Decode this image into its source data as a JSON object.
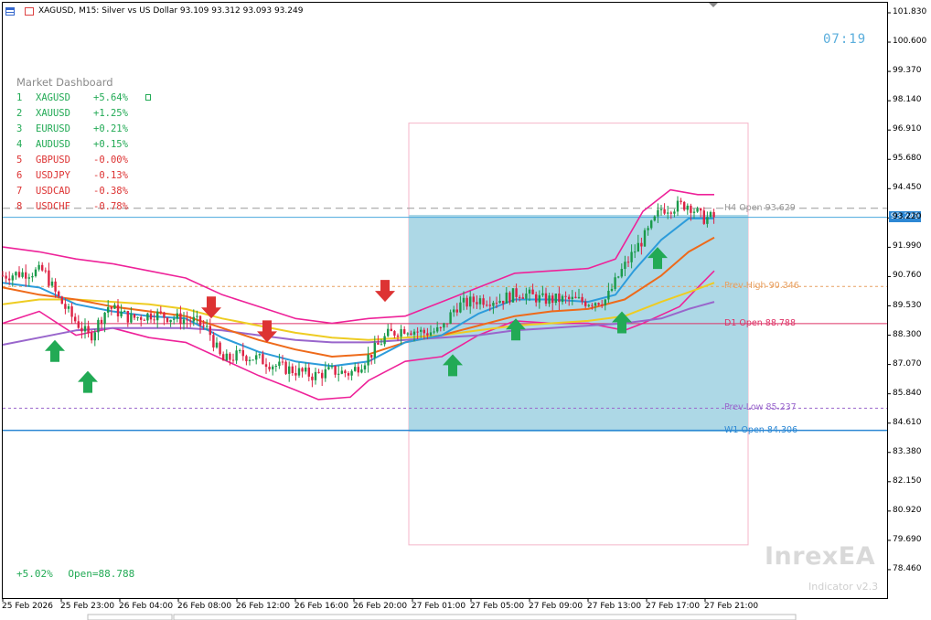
{
  "header": {
    "symbol_line": "XAGUSD, M15:  Silver vs US Dollar  93.109 93.312 93.093 93.249"
  },
  "clock": "07:19",
  "dashboard": {
    "title": "Market Dashboard",
    "rows": [
      {
        "rank": "1",
        "symbol": "XAGUSD",
        "change": "+5.64%",
        "color": "#22aa55"
      },
      {
        "rank": "2",
        "symbol": "XAUUSD",
        "change": "+1.25%",
        "color": "#22aa55"
      },
      {
        "rank": "3",
        "symbol": "EURUSD",
        "change": "+0.21%",
        "color": "#22aa55"
      },
      {
        "rank": "4",
        "symbol": "AUDUSD",
        "change": "+0.15%",
        "color": "#22aa55"
      },
      {
        "rank": "5",
        "symbol": "GBPUSD",
        "change": "-0.00%",
        "color": "#dd3333"
      },
      {
        "rank": "6",
        "symbol": "USDJPY",
        "change": "-0.13%",
        "color": "#dd3333"
      },
      {
        "rank": "7",
        "symbol": "USDCAD",
        "change": "-0.38%",
        "color": "#dd3333"
      },
      {
        "rank": "8",
        "symbol": "USDCHF",
        "change": "-0.78%",
        "color": "#dd3333"
      }
    ]
  },
  "summary": {
    "change": "+5.02%",
    "open": "Open=88.788"
  },
  "brand": {
    "name": "InrexEA",
    "version": "Indicator v2.3"
  },
  "current_price": "93.249",
  "levels": [
    {
      "label": "H4 Open  93.629",
      "price": 93.629,
      "color": "#999999",
      "style": "dashed"
    },
    {
      "label": "Prev High  90.346",
      "price": 90.346,
      "color": "#e8a060",
      "style": "dotted"
    },
    {
      "label": "D1 Open  88.788",
      "price": 88.788,
      "color": "#dd3366",
      "style": "solid"
    },
    {
      "label": "Prev Low  85.237",
      "price": 85.237,
      "color": "#9966cc",
      "style": "dotted"
    },
    {
      "label": "W1 Open  84.306",
      "price": 84.306,
      "color": "#2d88d4",
      "style": "solid"
    }
  ],
  "colors": {
    "bull_candle": "#1a9a4a",
    "bear_candle": "#dd2244",
    "bollinger": "#ee2299",
    "ma_fast": "#2d9cdb",
    "ma_mid": "#ee6a1a",
    "ma_slow": "#eecc22",
    "ma_long": "#9966cc",
    "zone_fill": "#add8e6",
    "zone_border": "#f4b6c8",
    "buy_arrow": "#22aa55",
    "sell_arrow": "#dd3333"
  },
  "chart_data": {
    "type": "candlestick",
    "symbol": "XAGUSD",
    "timeframe": "M15",
    "y_ticks": [
      "101.830",
      "100.600",
      "99.370",
      "98.140",
      "96.910",
      "95.680",
      "94.450",
      "93.220",
      "91.990",
      "90.760",
      "89.530",
      "88.300",
      "87.070",
      "85.840",
      "84.610",
      "83.380",
      "82.150",
      "80.920",
      "79.690",
      "78.460"
    ],
    "ylim": [
      77.6,
      102.5
    ],
    "x_ticks": [
      "25 Feb 2026",
      "25 Feb 23:00",
      "26 Feb 04:00",
      "26 Feb 08:00",
      "26 Feb 12:00",
      "26 Feb 16:00",
      "26 Feb 20:00",
      "27 Feb 01:00",
      "27 Feb 05:00",
      "27 Feb 09:00",
      "27 Feb 13:00",
      "27 Feb 17:00",
      "27 Feb 21:00"
    ],
    "price_path": [
      [
        0,
        90.8
      ],
      [
        20,
        90.9
      ],
      [
        45,
        91.0
      ],
      [
        60,
        89.9
      ],
      [
        75,
        89.1
      ],
      [
        95,
        88.2
      ],
      [
        115,
        89.5
      ],
      [
        140,
        89.0
      ],
      [
        165,
        89.2
      ],
      [
        190,
        89.0
      ],
      [
        210,
        88.9
      ],
      [
        225,
        88.5
      ],
      [
        240,
        87.2
      ],
      [
        260,
        87.5
      ],
      [
        280,
        87.3
      ],
      [
        300,
        87.0
      ],
      [
        320,
        86.8
      ],
      [
        340,
        86.6
      ],
      [
        360,
        86.8
      ],
      [
        380,
        86.7
      ],
      [
        400,
        87.4
      ],
      [
        420,
        88.3
      ],
      [
        440,
        88.6
      ],
      [
        460,
        88.4
      ],
      [
        480,
        88.5
      ],
      [
        495,
        89.5
      ],
      [
        520,
        89.8
      ],
      [
        545,
        89.8
      ],
      [
        565,
        90.1
      ],
      [
        590,
        89.8
      ],
      [
        615,
        89.8
      ],
      [
        640,
        89.7
      ],
      [
        660,
        89.8
      ],
      [
        675,
        90.9
      ],
      [
        690,
        91.8
      ],
      [
        705,
        92.6
      ],
      [
        720,
        93.6
      ],
      [
        735,
        93.7
      ],
      [
        750,
        93.8
      ],
      [
        765,
        93.2
      ],
      [
        778,
        93.25
      ]
    ],
    "bollinger_upper": [
      [
        0,
        92.0
      ],
      [
        40,
        91.8
      ],
      [
        80,
        91.5
      ],
      [
        120,
        91.3
      ],
      [
        160,
        91.0
      ],
      [
        200,
        90.7
      ],
      [
        240,
        90.0
      ],
      [
        280,
        89.5
      ],
      [
        320,
        89.0
      ],
      [
        360,
        88.8
      ],
      [
        400,
        89.0
      ],
      [
        440,
        89.1
      ],
      [
        480,
        89.7
      ],
      [
        520,
        90.3
      ],
      [
        560,
        90.9
      ],
      [
        600,
        91.0
      ],
      [
        640,
        91.1
      ],
      [
        670,
        91.5
      ],
      [
        700,
        93.5
      ],
      [
        730,
        94.4
      ],
      [
        760,
        94.2
      ],
      [
        778,
        94.2
      ]
    ],
    "bollinger_lower": [
      [
        0,
        88.8
      ],
      [
        40,
        89.3
      ],
      [
        80,
        88.3
      ],
      [
        120,
        88.6
      ],
      [
        160,
        88.2
      ],
      [
        200,
        88.0
      ],
      [
        240,
        87.3
      ],
      [
        280,
        86.6
      ],
      [
        320,
        86.0
      ],
      [
        345,
        85.6
      ],
      [
        380,
        85.7
      ],
      [
        400,
        86.4
      ],
      [
        440,
        87.2
      ],
      [
        480,
        87.4
      ],
      [
        520,
        88.3
      ],
      [
        560,
        88.9
      ],
      [
        600,
        88.8
      ],
      [
        640,
        88.8
      ],
      [
        680,
        88.5
      ],
      [
        700,
        88.8
      ],
      [
        740,
        89.5
      ],
      [
        760,
        90.3
      ],
      [
        778,
        91.0
      ]
    ],
    "ma_fast": [
      [
        0,
        90.5
      ],
      [
        40,
        90.3
      ],
      [
        80,
        89.6
      ],
      [
        120,
        89.3
      ],
      [
        160,
        89.1
      ],
      [
        200,
        89.0
      ],
      [
        240,
        88.2
      ],
      [
        280,
        87.6
      ],
      [
        320,
        87.2
      ],
      [
        360,
        87.0
      ],
      [
        400,
        87.2
      ],
      [
        440,
        88.0
      ],
      [
        480,
        88.3
      ],
      [
        520,
        89.2
      ],
      [
        560,
        89.8
      ],
      [
        600,
        89.8
      ],
      [
        640,
        89.7
      ],
      [
        670,
        90.0
      ],
      [
        690,
        91.0
      ],
      [
        720,
        92.3
      ],
      [
        750,
        93.2
      ],
      [
        778,
        93.2
      ]
    ],
    "ma_mid": [
      [
        0,
        90.3
      ],
      [
        40,
        90.0
      ],
      [
        80,
        89.8
      ],
      [
        120,
        89.5
      ],
      [
        160,
        89.3
      ],
      [
        200,
        89.1
      ],
      [
        240,
        88.6
      ],
      [
        280,
        88.1
      ],
      [
        320,
        87.7
      ],
      [
        360,
        87.4
      ],
      [
        400,
        87.5
      ],
      [
        440,
        88.0
      ],
      [
        480,
        88.3
      ],
      [
        520,
        88.7
      ],
      [
        560,
        89.1
      ],
      [
        600,
        89.3
      ],
      [
        640,
        89.4
      ],
      [
        680,
        89.8
      ],
      [
        720,
        90.8
      ],
      [
        750,
        91.8
      ],
      [
        778,
        92.4
      ]
    ],
    "ma_slow": [
      [
        0,
        89.6
      ],
      [
        40,
        89.8
      ],
      [
        80,
        89.8
      ],
      [
        120,
        89.7
      ],
      [
        160,
        89.6
      ],
      [
        200,
        89.4
      ],
      [
        240,
        89.0
      ],
      [
        280,
        88.7
      ],
      [
        320,
        88.4
      ],
      [
        360,
        88.2
      ],
      [
        400,
        88.1
      ],
      [
        440,
        88.2
      ],
      [
        480,
        88.3
      ],
      [
        520,
        88.5
      ],
      [
        560,
        88.7
      ],
      [
        600,
        88.8
      ],
      [
        640,
        88.9
      ],
      [
        680,
        89.1
      ],
      [
        720,
        89.7
      ],
      [
        750,
        90.1
      ],
      [
        778,
        90.5
      ]
    ],
    "ma_long": [
      [
        0,
        87.9
      ],
      [
        40,
        88.2
      ],
      [
        80,
        88.5
      ],
      [
        120,
        88.6
      ],
      [
        160,
        88.6
      ],
      [
        200,
        88.6
      ],
      [
        240,
        88.5
      ],
      [
        280,
        88.3
      ],
      [
        320,
        88.1
      ],
      [
        360,
        88.0
      ],
      [
        400,
        88.0
      ],
      [
        440,
        88.1
      ],
      [
        480,
        88.2
      ],
      [
        520,
        88.3
      ],
      [
        560,
        88.5
      ],
      [
        600,
        88.6
      ],
      [
        640,
        88.7
      ],
      [
        680,
        88.8
      ],
      [
        720,
        89.0
      ],
      [
        750,
        89.4
      ],
      [
        778,
        89.7
      ]
    ],
    "buy_arrows": [
      [
        57,
        88.1
      ],
      [
        93,
        86.8
      ],
      [
        492,
        87.5
      ],
      [
        561,
        89.0
      ],
      [
        677,
        89.3
      ],
      [
        716,
        92.0
      ]
    ],
    "sell_arrows": [
      [
        418,
        89.7
      ],
      [
        228,
        89.0
      ],
      [
        289,
        88.0
      ]
    ],
    "zone": {
      "x_start": 447,
      "x_end": 818,
      "top_price": 97.2,
      "fill_top": 93.35,
      "fill_bottom": 84.25,
      "bottom_price": 79.5
    }
  }
}
